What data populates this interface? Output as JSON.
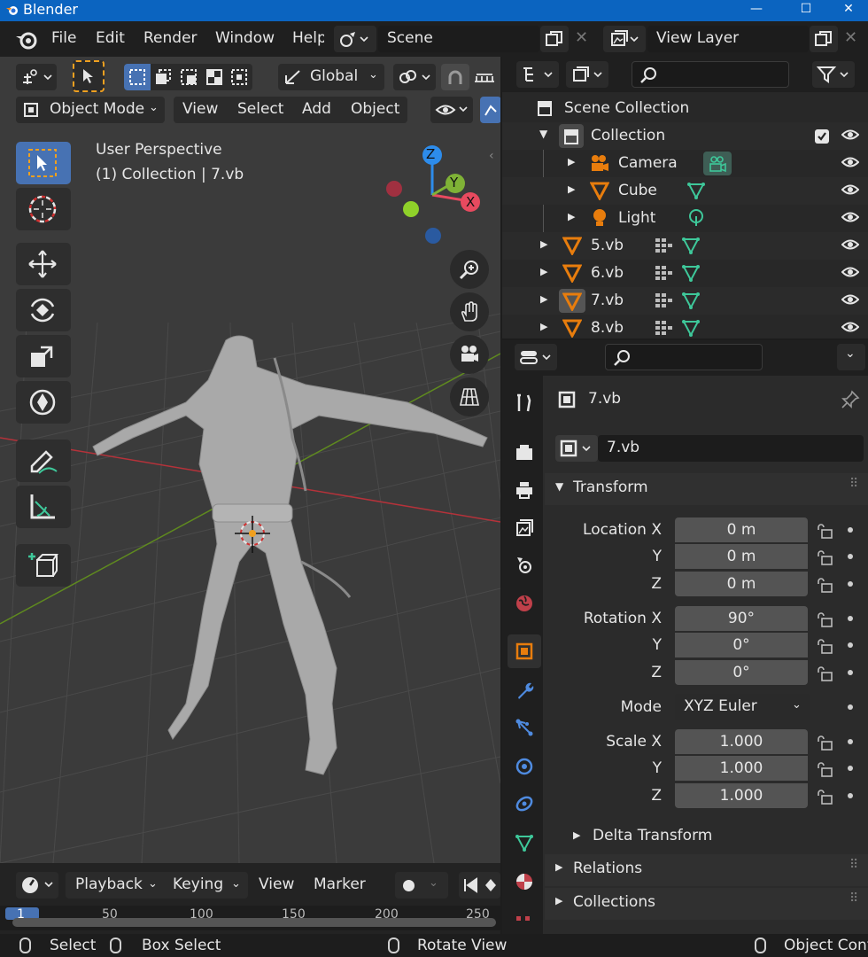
{
  "window": {
    "title": "Blender",
    "minimize": "—",
    "maximize": "☐",
    "close": "✕"
  },
  "menu": [
    "File",
    "Edit",
    "Render",
    "Window",
    "Help"
  ],
  "scene": {
    "name": "Scene"
  },
  "view_layer": {
    "name": "View Layer"
  },
  "viewport_header": {
    "orientation": "Global",
    "mode": "Object Mode",
    "menus": [
      "View",
      "Select",
      "Add",
      "Object"
    ]
  },
  "viewport": {
    "perspective_label": "User Perspective",
    "collection_label": "(1) Collection | 7.vb",
    "gizmo_axes": {
      "z": "Z",
      "y": "Y",
      "x": "X"
    },
    "colors": {
      "x_axis": "#e84a5f",
      "y_axis": "#7fb236",
      "z_axis": "#2d8ceb"
    }
  },
  "timeline": {
    "menus": [
      "Playback",
      "Keying",
      "View",
      "Marker"
    ],
    "frames": [
      "1",
      "50",
      "100",
      "150",
      "200",
      "250"
    ]
  },
  "outliner": {
    "root": "Scene Collection",
    "rows": [
      {
        "name": "Collection"
      },
      {
        "name": "Camera"
      },
      {
        "name": "Cube"
      },
      {
        "name": "Light"
      },
      {
        "name": "5.vb"
      },
      {
        "name": "6.vb"
      },
      {
        "name": "7.vb"
      },
      {
        "name": "8.vb"
      }
    ]
  },
  "properties": {
    "object_name": "7.vb",
    "object_field": "7.vb",
    "transform_title": "Transform",
    "location": {
      "label_x": "Location X",
      "label_y": "Y",
      "label_z": "Z",
      "x": "0 m",
      "y": "0 m",
      "z": "0 m"
    },
    "rotation": {
      "label_x": "Rotation X",
      "label_y": "Y",
      "label_z": "Z",
      "x": "90°",
      "y": "0°",
      "z": "0°"
    },
    "mode": {
      "label": "Mode",
      "value": "XYZ Euler"
    },
    "scale": {
      "label_x": "Scale X",
      "label_y": "Y",
      "label_z": "Z",
      "x": "1.000",
      "y": "1.000",
      "z": "1.000"
    },
    "delta_transform": "Delta Transform",
    "relations": "Relations",
    "collections": "Collections",
    "accent_color": "#e87d0d"
  },
  "statusbar": {
    "select": "Select",
    "box_select": "Box Select",
    "rotate_view": "Rotate View",
    "object_context": "Object Cont"
  }
}
